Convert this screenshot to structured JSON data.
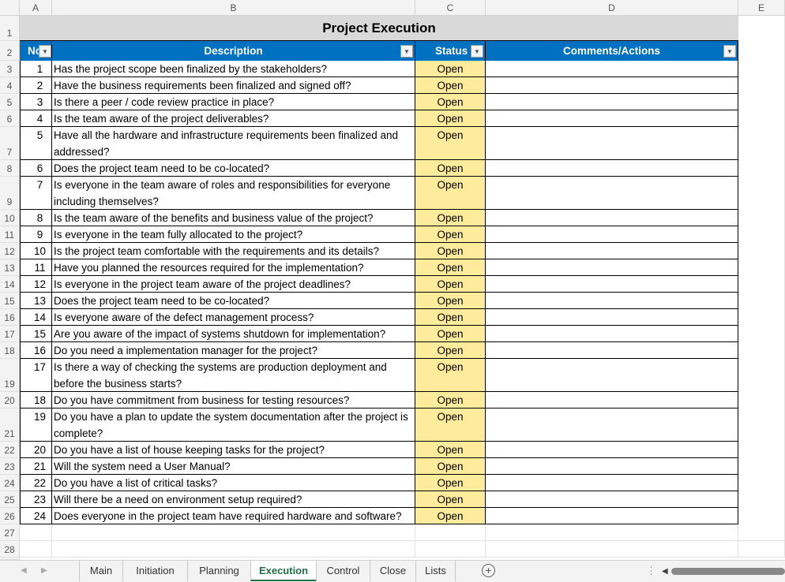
{
  "columns": [
    "A",
    "B",
    "C",
    "D",
    "E"
  ],
  "title": "Project Execution",
  "headers": {
    "no": "No",
    "description": "Description",
    "status": "Status",
    "comments": "Comments/Actions"
  },
  "colors": {
    "header_bg": "#0070c0",
    "status_bg": "#ffeb9c",
    "title_bg": "#d9d9d9",
    "active_tab": "#1e7145"
  },
  "rows": [
    {
      "no": "1",
      "description": "Has the project scope been finalized by the stakeholders?",
      "status": "Open",
      "comments": ""
    },
    {
      "no": "2",
      "description": "Have the business requirements been finalized and signed off?",
      "status": "Open",
      "comments": ""
    },
    {
      "no": "3",
      "description": "Is there a peer / code review practice in place?",
      "status": "Open",
      "comments": ""
    },
    {
      "no": "4",
      "description": "Is the team aware of the project deliverables?",
      "status": "Open",
      "comments": ""
    },
    {
      "no": "5",
      "description": "Have all the hardware and infrastructure requirements been finalized and addressed?",
      "status": "Open",
      "comments": "",
      "tall": true
    },
    {
      "no": "6",
      "description": "Does the project team need to be co-located?",
      "status": "Open",
      "comments": ""
    },
    {
      "no": "7",
      "description": "Is everyone in the team aware of roles and responsibilities for everyone including themselves?",
      "status": "Open",
      "comments": "",
      "tall": true
    },
    {
      "no": "8",
      "description": "Is the team aware of the benefits and business value of the project?",
      "status": "Open",
      "comments": ""
    },
    {
      "no": "9",
      "description": "Is everyone in the team fully allocated to the project?",
      "status": "Open",
      "comments": ""
    },
    {
      "no": "10",
      "description": "Is the project team comfortable with the requirements and its details?",
      "status": "Open",
      "comments": ""
    },
    {
      "no": "11",
      "description": "Have you planned the resources required for the implementation?",
      "status": "Open",
      "comments": ""
    },
    {
      "no": "12",
      "description": "Is everyone in the project team aware of the project deadlines?",
      "status": "Open",
      "comments": ""
    },
    {
      "no": "13",
      "description": "Does the project team need to be co-located?",
      "status": "Open",
      "comments": ""
    },
    {
      "no": "14",
      "description": "Is everyone aware of the defect management process?",
      "status": "Open",
      "comments": ""
    },
    {
      "no": "15",
      "description": "Are you aware of the impact of systems shutdown for implementation?",
      "status": "Open",
      "comments": ""
    },
    {
      "no": "16",
      "description": "Do you need a implementation manager for the project?",
      "status": "Open",
      "comments": ""
    },
    {
      "no": "17",
      "description": "Is there a way of checking the systems are production deployment and before the business starts?",
      "status": "Open",
      "comments": "",
      "tall": true
    },
    {
      "no": "18",
      "description": "Do you have commitment from business for testing resources?",
      "status": "Open",
      "comments": ""
    },
    {
      "no": "19",
      "description": "Do you have a plan to update the system documentation after the project is complete?",
      "status": "Open",
      "comments": "",
      "tall": true
    },
    {
      "no": "20",
      "description": "Do you have a list of house keeping tasks for the project?",
      "status": "Open",
      "comments": ""
    },
    {
      "no": "21",
      "description": "Will the system need a User Manual?",
      "status": "Open",
      "comments": ""
    },
    {
      "no": "22",
      "description": "Do you have a list of critical tasks?",
      "status": "Open",
      "comments": ""
    },
    {
      "no": "23",
      "description": "Will there be a need on environment setup required?",
      "status": "Open",
      "comments": ""
    },
    {
      "no": "24",
      "description": "Does everyone in the project team have required hardware and software?",
      "status": "Open",
      "comments": ""
    }
  ],
  "sheet_tabs": [
    "Main",
    "Initiation",
    "Planning",
    "Execution",
    "Control",
    "Close",
    "Lists"
  ],
  "active_tab": "Execution"
}
